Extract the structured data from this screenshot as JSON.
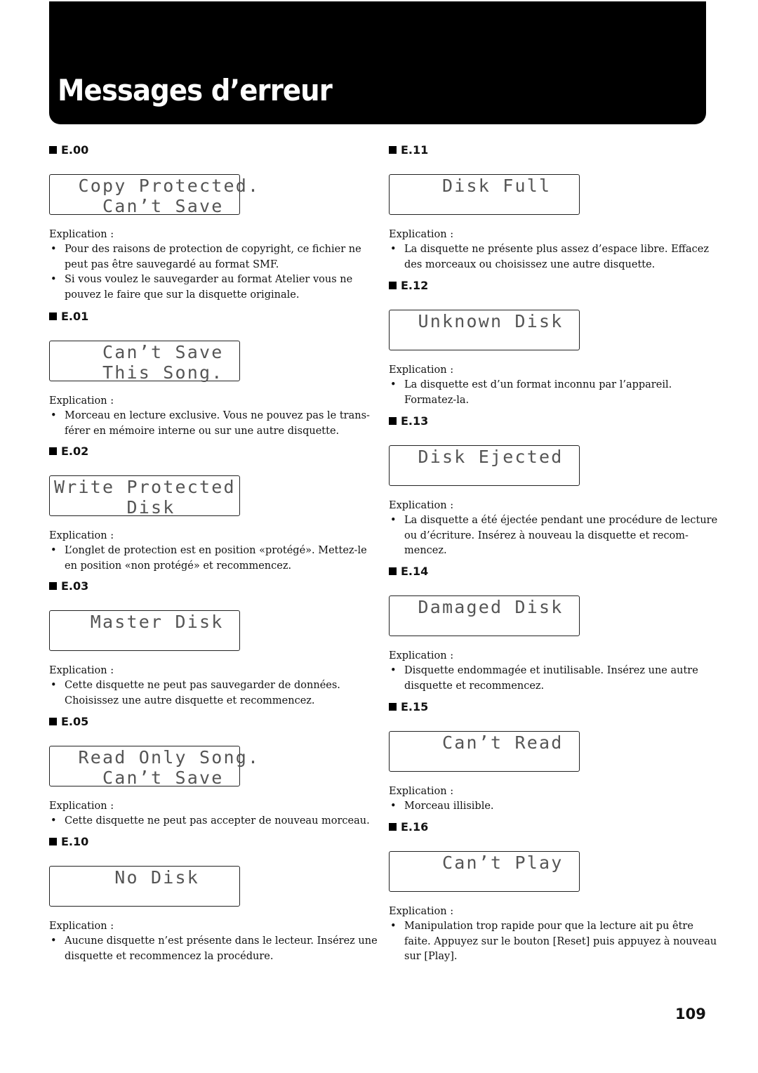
{
  "header": {
    "title": "Messages d’erreur"
  },
  "explication_label": "Explication :",
  "bullet_glyph": "•",
  "left_column": [
    {
      "code": "E.00",
      "lcd": [
        "  Copy Protected.",
        "    Can’t Save"
      ],
      "bullets": [
        "Pour des raisons de protection de copyright, ce fichier ne peut pas être sauvegardé au format SMF.",
        "Si vous voulez le sauvegarder au format Atelier vous ne pouvez le faire que sur la disquette originale."
      ]
    },
    {
      "code": "E.01",
      "lcd": [
        "    Can’t Save",
        "    This Song."
      ],
      "bullets": [
        "Morceau en lecture exclusive. Vous ne pouvez pas le trans-férer en mémoire interne ou sur une autre disquette."
      ]
    },
    {
      "code": "E.02",
      "lcd": [
        "Write Protected",
        "      Disk"
      ],
      "bullets": [
        "L’onglet de protection est en position «protégé». Mettez-le en position «non protégé» et recommencez."
      ]
    },
    {
      "code": "E.03",
      "lcd": [
        "   Master Disk",
        ""
      ],
      "bullets": [
        "Cette disquette ne peut pas sauvegarder de données. Choisissez une autre disquette et recommencez."
      ]
    },
    {
      "code": "E.05",
      "lcd": [
        "  Read Only Song.",
        "    Can’t Save"
      ],
      "bullets": [
        "Cette disquette ne peut pas accepter de nouveau morceau."
      ]
    },
    {
      "code": "E.10",
      "lcd": [
        "     No Disk",
        ""
      ],
      "bullets": [
        "Aucune disquette n’est présente dans le lecteur. Insérez une disquette et recommencez la procédure."
      ]
    }
  ],
  "right_column": [
    {
      "code": "E.11",
      "lcd": [
        "    Disk Full",
        ""
      ],
      "bullets": [
        "La disquette ne présente plus assez d’espace libre. Effacez des morceaux ou choisissez une autre disquette."
      ]
    },
    {
      "code": "E.12",
      "lcd": [
        "  Unknown Disk",
        ""
      ],
      "bullets": [
        "La disquette est d’un format inconnu par l’appareil. Formatez-la."
      ]
    },
    {
      "code": "E.13",
      "lcd": [
        "  Disk Ejected",
        ""
      ],
      "bullets": [
        "La disquette a été éjectée pendant une procédure de lecture ou d’écriture. Insérez à nouveau la disquette et recom-mencez."
      ]
    },
    {
      "code": "E.14",
      "lcd": [
        "  Damaged Disk",
        ""
      ],
      "bullets": [
        "Disquette endommagée et inutilisable. Insérez une autre disquette et recommencez."
      ]
    },
    {
      "code": "E.15",
      "lcd": [
        "    Can’t Read",
        ""
      ],
      "bullets": [
        "Morceau illisible."
      ]
    },
    {
      "code": "E.16",
      "lcd": [
        "    Can’t Play",
        ""
      ],
      "bullets": [
        "Manipulation trop rapide pour que la lecture ait pu être faite. Appuyez sur le bouton [Reset] puis appuyez à nouveau sur [Play]."
      ]
    }
  ],
  "footer": {
    "page_number": "109"
  }
}
